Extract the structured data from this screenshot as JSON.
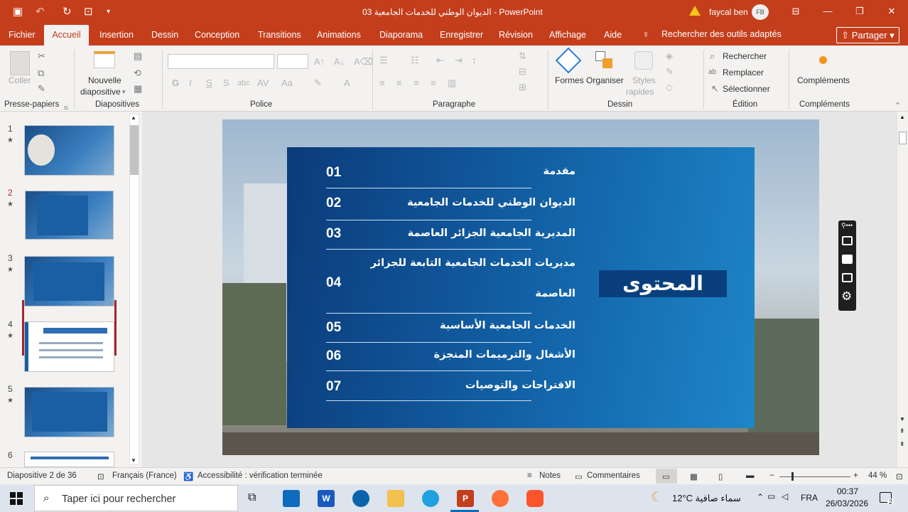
{
  "window": {
    "title": "الديوان الوطني للخدمات الجامعية 03  -  PowerPoint",
    "user": "faycal ben",
    "avatar_initials": "FB"
  },
  "tabs": [
    "Fichier",
    "Accueil",
    "Insertion",
    "Dessin",
    "Conception",
    "Transitions",
    "Animations",
    "Diaporama",
    "Enregistrer",
    "Révision",
    "Affichage",
    "Aide"
  ],
  "active_tab": "Accueil",
  "search_tools": "Rechercher des outils adaptés",
  "share_label": "Partager",
  "ribbon": {
    "paste": "Coller",
    "new_slide_1": "Nouvelle",
    "new_slide_2": "diapositive",
    "shapes": "Formes",
    "arrange": "Organiser",
    "styles_1": "Styles",
    "styles_2": "rapides",
    "find": "Rechercher",
    "replace": "Remplacer",
    "select": "Sélectionner",
    "addins": "Compléments",
    "groups": {
      "clipboard": "Presse-papiers",
      "slides": "Diapositives",
      "font": "Police",
      "paragraph": "Paragraphe",
      "drawing": "Dessin",
      "editing": "Édition",
      "addins": "Compléments"
    }
  },
  "thumbnails": [
    {
      "num": "1",
      "star": "★"
    },
    {
      "num": "2",
      "star": "★"
    },
    {
      "num": "3",
      "star": "★"
    },
    {
      "num": "4",
      "star": "★"
    },
    {
      "num": "5",
      "star": "★"
    },
    {
      "num": "6",
      "star": ""
    }
  ],
  "slide": {
    "title": "المحتوى",
    "items": [
      {
        "num": "01",
        "text": "مقدمة"
      },
      {
        "num": "02",
        "text": "الديوان الوطني للخدمات الجامعية"
      },
      {
        "num": "03",
        "text": "المديرية الجامعية الجزائر  العاصمة"
      },
      {
        "num": "04",
        "text": "مديريات الخدمات الجامعية التابعة للجزائر",
        "text2": "العاصمة"
      },
      {
        "num": "05",
        "text": "الخدمات الجامعية الأساسية"
      },
      {
        "num": "06",
        "text": "الأشغال والترميمات المنجزة"
      },
      {
        "num": "07",
        "text": "الاقتراحات والتوصيات"
      }
    ]
  },
  "status": {
    "slide_counter": "Diapositive 2 de 36",
    "language": "Français (France)",
    "accessibility": "Accessibilité : vérification terminée",
    "notes": "Notes",
    "comments": "Commentaires",
    "zoom": "44 %"
  },
  "taskbar": {
    "search_placeholder": "Taper ici pour rechercher",
    "weather": "12°C  سماء صافية",
    "lang": "FRA",
    "time": "00:37",
    "date": "26/03/2026",
    "notif_count": "2"
  },
  "colors": {
    "accent": "#c43e1c",
    "panel_dark": "#0b3b7a",
    "panel_light": "#1e86c8",
    "selected_thumb": "#a4262c"
  }
}
